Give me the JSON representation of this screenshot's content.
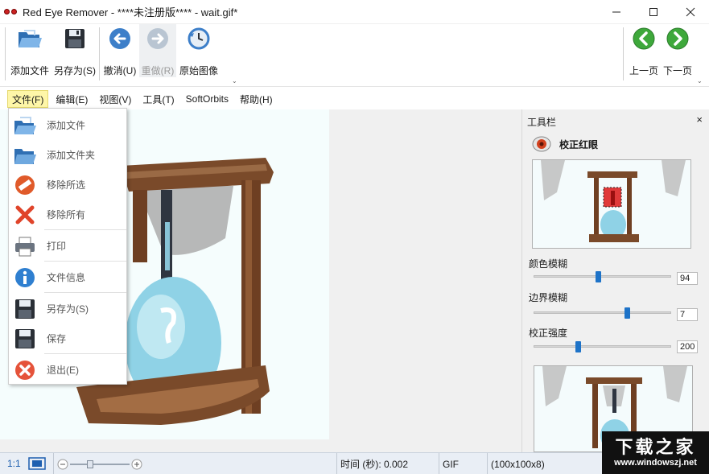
{
  "window": {
    "title": "Red Eye Remover - ****未注册版**** - wait.gif*",
    "controls": [
      "—",
      "☐",
      "✕"
    ]
  },
  "toolbar": {
    "add_file": "添加文件",
    "save_as": "另存为(S)",
    "undo": "撤消(U)",
    "redo": "重做(R)",
    "original": "原始图像",
    "prev_page": "上一页",
    "next_page": "下一页",
    "grip": "⌄"
  },
  "menu": {
    "file": "文件(F)",
    "edit": "编辑(E)",
    "view": "视图(V)",
    "tools": "工具(T)",
    "softorbits": "SoftOrbits",
    "help": "帮助(H)"
  },
  "file_menu": {
    "items": [
      {
        "label": "添加文件",
        "icon": "open-file-icon"
      },
      {
        "label": "添加文件夹",
        "icon": "folder-icon"
      },
      {
        "label": "移除所选",
        "icon": "remove-selected-icon"
      },
      {
        "label": "移除所有",
        "icon": "remove-all-icon"
      },
      {
        "label": "打印",
        "icon": "printer-icon"
      },
      {
        "label": "文件信息",
        "icon": "info-icon"
      },
      {
        "label": "另存为(S)",
        "icon": "save-as-icon"
      },
      {
        "label": "保存",
        "icon": "save-icon"
      },
      {
        "label": "退出(E)",
        "icon": "exit-icon"
      }
    ]
  },
  "panel": {
    "title": "工具栏",
    "close": "×",
    "section": "校正红眼",
    "sliders": [
      {
        "label": "颜色模糊",
        "value": "94",
        "fraction": 0.47
      },
      {
        "label": "边界模糊",
        "value": "7",
        "fraction": 0.68
      },
      {
        "label": "校正强度",
        "value": "200",
        "fraction": 0.32
      }
    ]
  },
  "status": {
    "zoom_ratio": "1:1",
    "time": "时间 (秒): 0.002",
    "format": "GIF",
    "dimensions": "(100x100x8)",
    "zoom_level": 0.3
  },
  "watermark": {
    "title": "下载之家",
    "url": "www.windowszj.net"
  },
  "colors": {
    "accent": "#1e73c8",
    "menu_highlight": "#fef6a8",
    "wood": "#7a4a2a",
    "glass_blue": "#8fd2e6"
  }
}
